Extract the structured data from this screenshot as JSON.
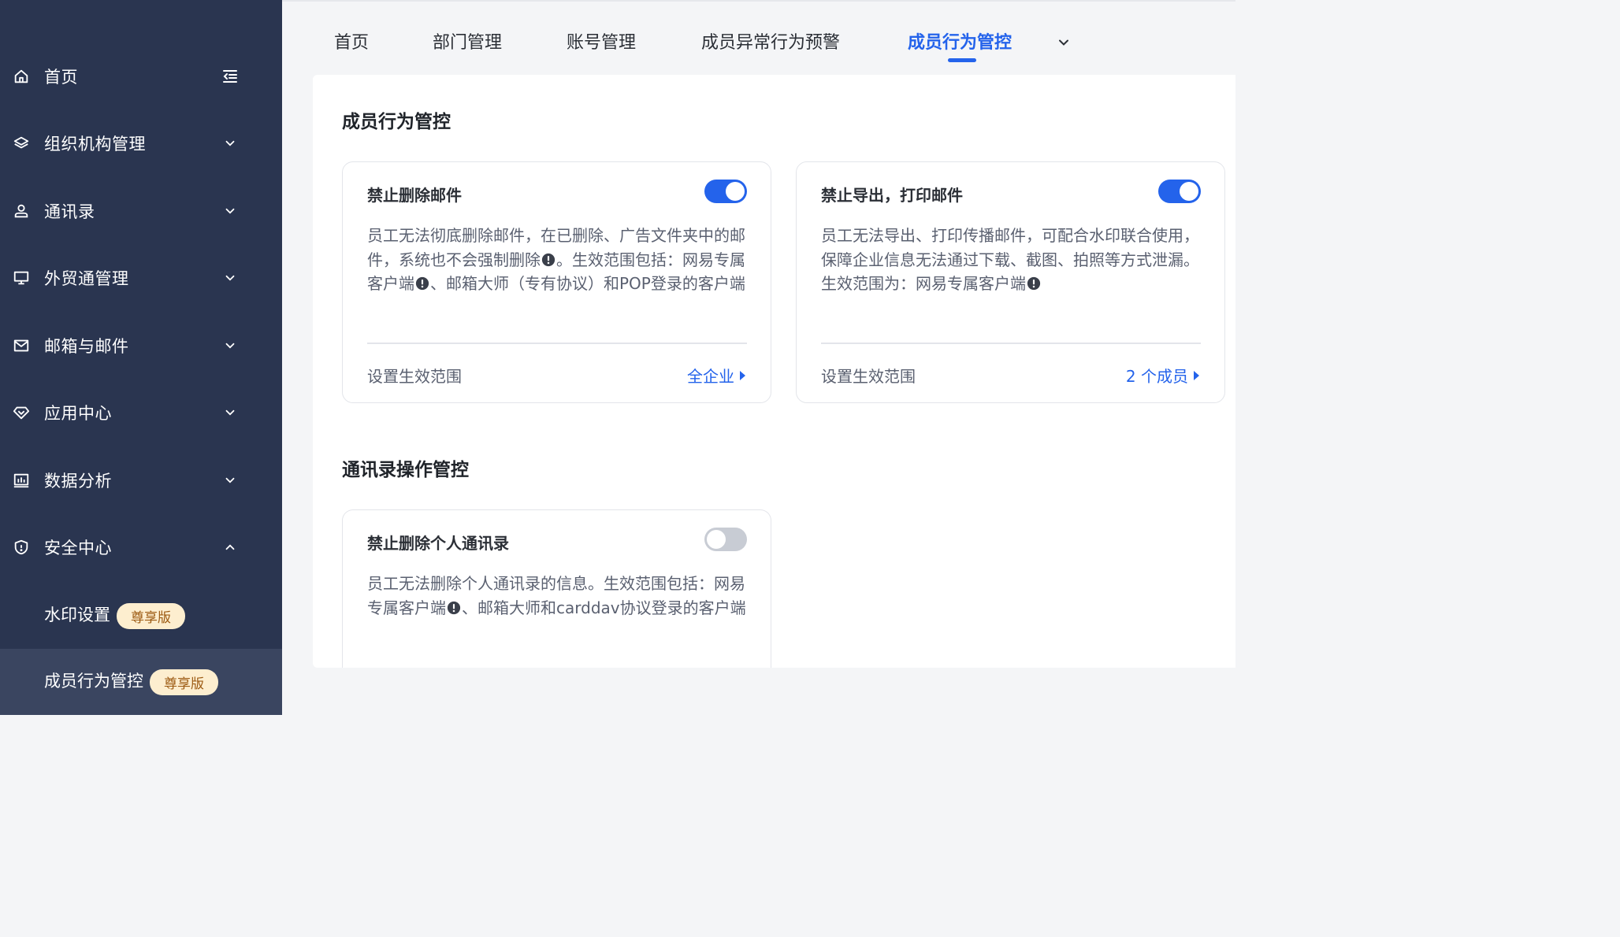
{
  "sidebar": {
    "items": [
      {
        "label": "首页"
      },
      {
        "label": "组织机构管理"
      },
      {
        "label": "通讯录"
      },
      {
        "label": "外贸通管理"
      },
      {
        "label": "邮箱与邮件"
      },
      {
        "label": "应用中心"
      },
      {
        "label": "数据分析"
      },
      {
        "label": "安全中心"
      }
    ],
    "sub_items": [
      {
        "label": "水印设置",
        "badge": "尊享版"
      },
      {
        "label": "成员行为管控",
        "badge": "尊享版"
      }
    ]
  },
  "tabs": [
    {
      "label": "首页"
    },
    {
      "label": "部门管理"
    },
    {
      "label": "账号管理"
    },
    {
      "label": "成员异常行为预警"
    },
    {
      "label": "成员行为管控"
    }
  ],
  "sections": [
    {
      "title": "成员行为管控",
      "cards": [
        {
          "title": "禁止删除邮件",
          "toggle": "on",
          "desc_1": "员工无法彻底删除邮件，在已删除、广告文件夹中的邮件，系统也不会强制删除",
          "desc_2": "。生效范围包括：网易专属客户端",
          "desc_3": "、邮箱大师（专有协议）和POP登录的客户端",
          "footer_label": "设置生效范围",
          "footer_link": "全企业"
        },
        {
          "title": "禁止导出，打印邮件",
          "toggle": "on",
          "desc_1": "员工无法导出、打印传播邮件，可配合水印联合使用，保障企业信息无法通过下载、截图、拍照等方式泄漏。生效范围为：网易专属客户端",
          "footer_label": "设置生效范围",
          "footer_link": "2 个成员"
        }
      ]
    },
    {
      "title": "通讯录操作管控",
      "cards": [
        {
          "title": "禁止删除个人通讯录",
          "toggle": "off",
          "desc_1": "员工无法删除个人通讯录的信息。生效范围包括：网易专属客户端",
          "desc_2": "、邮箱大师和carddav协议登录的客户端"
        }
      ]
    }
  ],
  "colors": {
    "sidebar_bg": "#2a3550",
    "accent": "#2463eb",
    "badge_bg": "#fdeecf",
    "badge_text": "#9c5a12"
  }
}
